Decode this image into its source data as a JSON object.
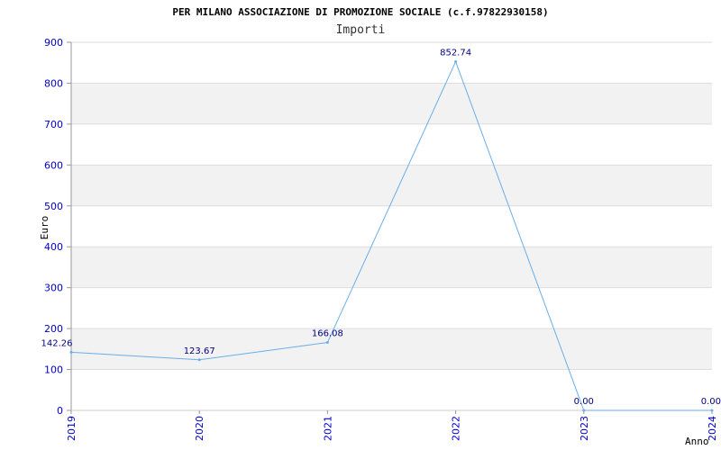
{
  "chart_data": {
    "type": "line",
    "title": "PER MILANO ASSOCIAZIONE DI PROMOZIONE SOCIALE (c.f.97822930158)",
    "subtitle": "Importi",
    "xlabel": "Anno",
    "ylabel": "Euro",
    "categories": [
      "2019",
      "2020",
      "2021",
      "2022",
      "2023",
      "2024"
    ],
    "values": [
      142.26,
      123.67,
      166.08,
      852.74,
      0.0,
      0.0
    ],
    "data_labels": [
      "142.26",
      "123.67",
      "166.08",
      "852.74",
      "0.00",
      "0.00"
    ],
    "ylim": [
      0,
      900
    ],
    "yticks": [
      "0",
      "100",
      "200",
      "300",
      "400",
      "500",
      "600",
      "700",
      "800",
      "900"
    ],
    "grid": true,
    "colors": {
      "line": "#6aaee8",
      "band": "#f2f2f2",
      "grid": "#dddddd",
      "tick_text": "#0000cc",
      "data_label": "#000080"
    }
  }
}
